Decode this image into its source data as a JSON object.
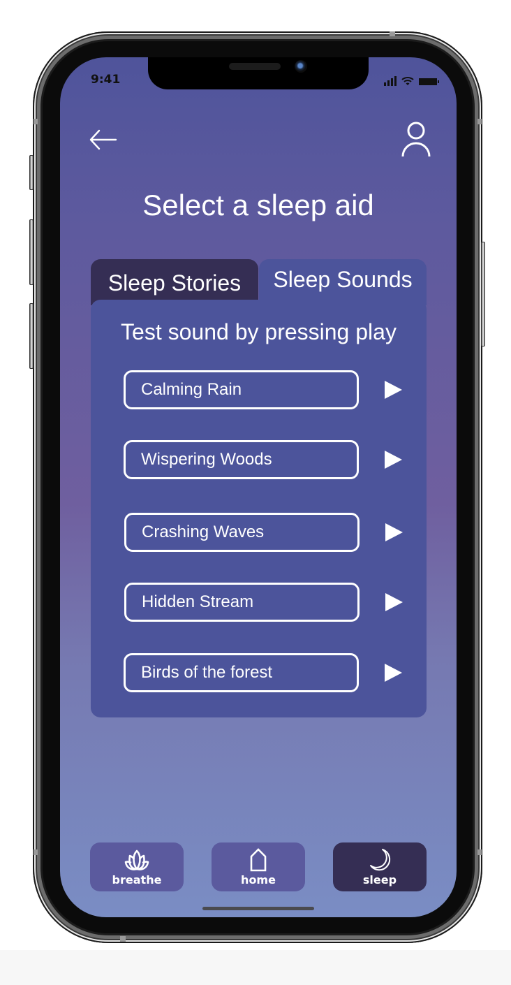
{
  "status_bar": {
    "time": "9:41",
    "icons": [
      "cellular-signal-icon",
      "wifi-icon",
      "battery-icon"
    ]
  },
  "header": {
    "back_icon": "arrow-left-icon",
    "profile_icon": "user-profile-icon",
    "title": "Select a sleep aid"
  },
  "tabs": [
    {
      "label": "Sleep Stories",
      "active": false
    },
    {
      "label": "Sleep Sounds",
      "active": true
    }
  ],
  "panel": {
    "instructions": "Test sound by pressing play",
    "sounds": [
      {
        "label": "Calming Rain",
        "action_icon": "play-icon"
      },
      {
        "label": "Wispering Woods",
        "action_icon": "play-icon"
      },
      {
        "label": "Crashing Waves",
        "action_icon": "play-icon"
      },
      {
        "label": "Hidden Stream",
        "action_icon": "play-icon"
      },
      {
        "label": "Birds of the forest",
        "action_icon": "play-icon"
      }
    ]
  },
  "bottom_nav": [
    {
      "label": "breathe",
      "icon": "lotus-icon",
      "active": false
    },
    {
      "label": "home",
      "icon": "house-icon",
      "active": false
    },
    {
      "label": "sleep",
      "icon": "moon-icon",
      "active": true
    }
  ],
  "colors": {
    "active_dark": "#352e54",
    "panel": "#4c549b",
    "nav_inactive": "#5b5a9e",
    "gradient_top": "#4f549b",
    "gradient_bottom": "#7a8dc4",
    "text": "#ffffff"
  }
}
